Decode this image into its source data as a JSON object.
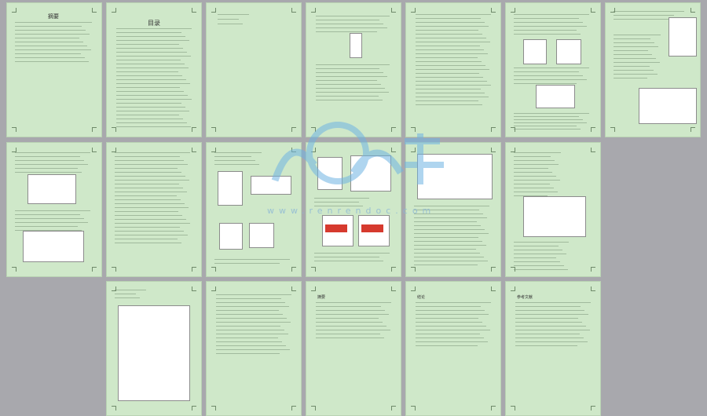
{
  "document": {
    "page1_title": "摘要",
    "page2_title": "目录",
    "page18_title": "摘要",
    "page19_title": "结论",
    "page20_title": "参考文献"
  },
  "watermark": {
    "url": "www.renrendoc.com",
    "accent": "#4aa3df"
  },
  "colors": {
    "page_background": "#cfe8c9",
    "viewer_background": "#a8a8ad",
    "highlight": "#d63a2e"
  }
}
